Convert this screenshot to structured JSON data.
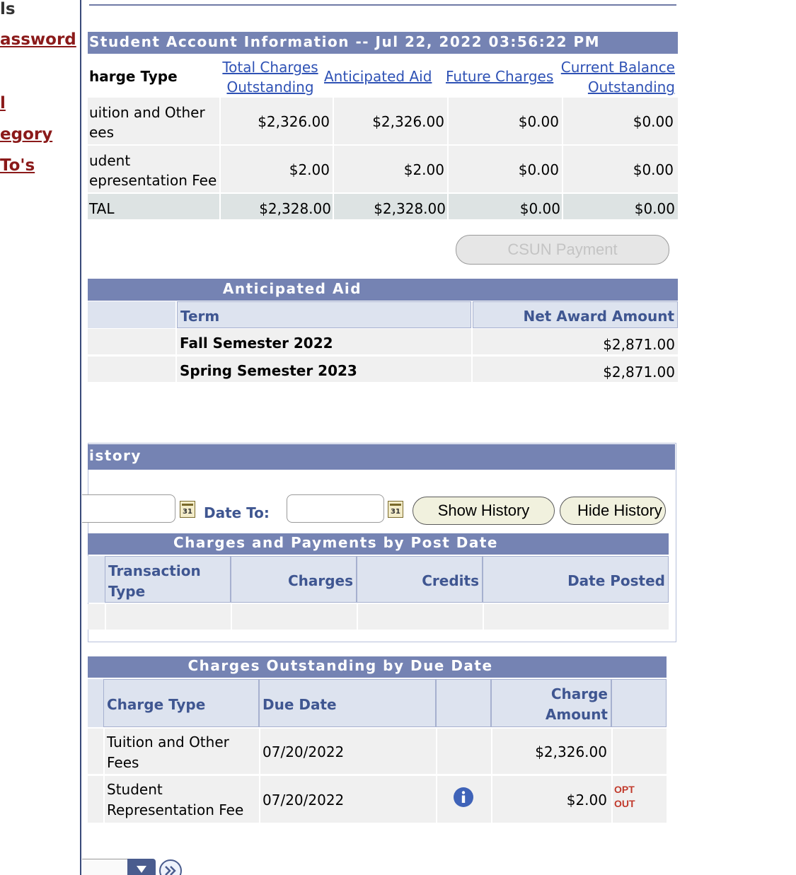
{
  "left_nav": {
    "heading": "ls",
    "links": [
      "assword",
      "l",
      "egory",
      "To's"
    ]
  },
  "account": {
    "title": "Student Account Information -- Jul 22, 2022 03:56:22 PM",
    "columns": {
      "charge_type": "harge Type",
      "total_1": "Total Charges",
      "total_2": "Outstanding",
      "anticipated": "Anticipated Aid",
      "future": "Future Charges",
      "balance_1": "Current Balance",
      "balance_2": "Outstanding"
    },
    "rows": [
      {
        "label_1": "uition and Other",
        "label_2": "ees",
        "total": "$2,326.00",
        "aid": "$2,326.00",
        "future": "$0.00",
        "balance": "$0.00"
      },
      {
        "label_1": "udent",
        "label_2": "epresentation Fee",
        "total": "$2.00",
        "aid": "$2.00",
        "future": "$0.00",
        "balance": "$0.00"
      }
    ],
    "total_row": {
      "label": "TAL",
      "total": "$2,328.00",
      "aid": "$2,328.00",
      "future": "$0.00",
      "balance": "$0.00"
    },
    "payment_button": "CSUN Payment"
  },
  "anticipated_aid": {
    "title": "Anticipated Aid",
    "col_term": "Term",
    "col_amount": "Net Award Amount",
    "rows": [
      {
        "term": "Fall Semester 2022",
        "amount": "$2,871.00"
      },
      {
        "term": "Spring Semester 2023",
        "amount": "$2,871.00"
      }
    ]
  },
  "history": {
    "title": "istory",
    "date_to_label": "Date To:",
    "show_button": "Show History",
    "hide_button": "Hide History",
    "post_table": {
      "title": "Charges and Payments by Post Date",
      "col_type_1": "Transaction",
      "col_type_2": "Type",
      "col_charges": "Charges",
      "col_credits": "Credits",
      "col_date": "Date Posted"
    }
  },
  "due": {
    "title": "Charges Outstanding by Due Date",
    "col_type": "Charge Type",
    "col_due": "Due Date",
    "col_amount_1": "Charge",
    "col_amount_2": "Amount",
    "rows": [
      {
        "type_1": "Tuition and Other",
        "type_2": "Fees",
        "due": "07/20/2022",
        "amount": "$2,326.00"
      },
      {
        "type_1": "Student",
        "type_2": "Representation Fee",
        "due": "07/20/2022",
        "amount": "$2.00"
      }
    ],
    "opt_out_1": "OPT",
    "opt_out_2": "OUT"
  },
  "icons": {
    "info": "info-icon",
    "calendar": "calendar-icon",
    "next": "double-chevron-right-icon",
    "dropdown": "dropdown-arrow-icon"
  },
  "colors": {
    "header_band": "#7583b3",
    "link": "#2f52b5",
    "nav_link": "#8b1a1a"
  }
}
